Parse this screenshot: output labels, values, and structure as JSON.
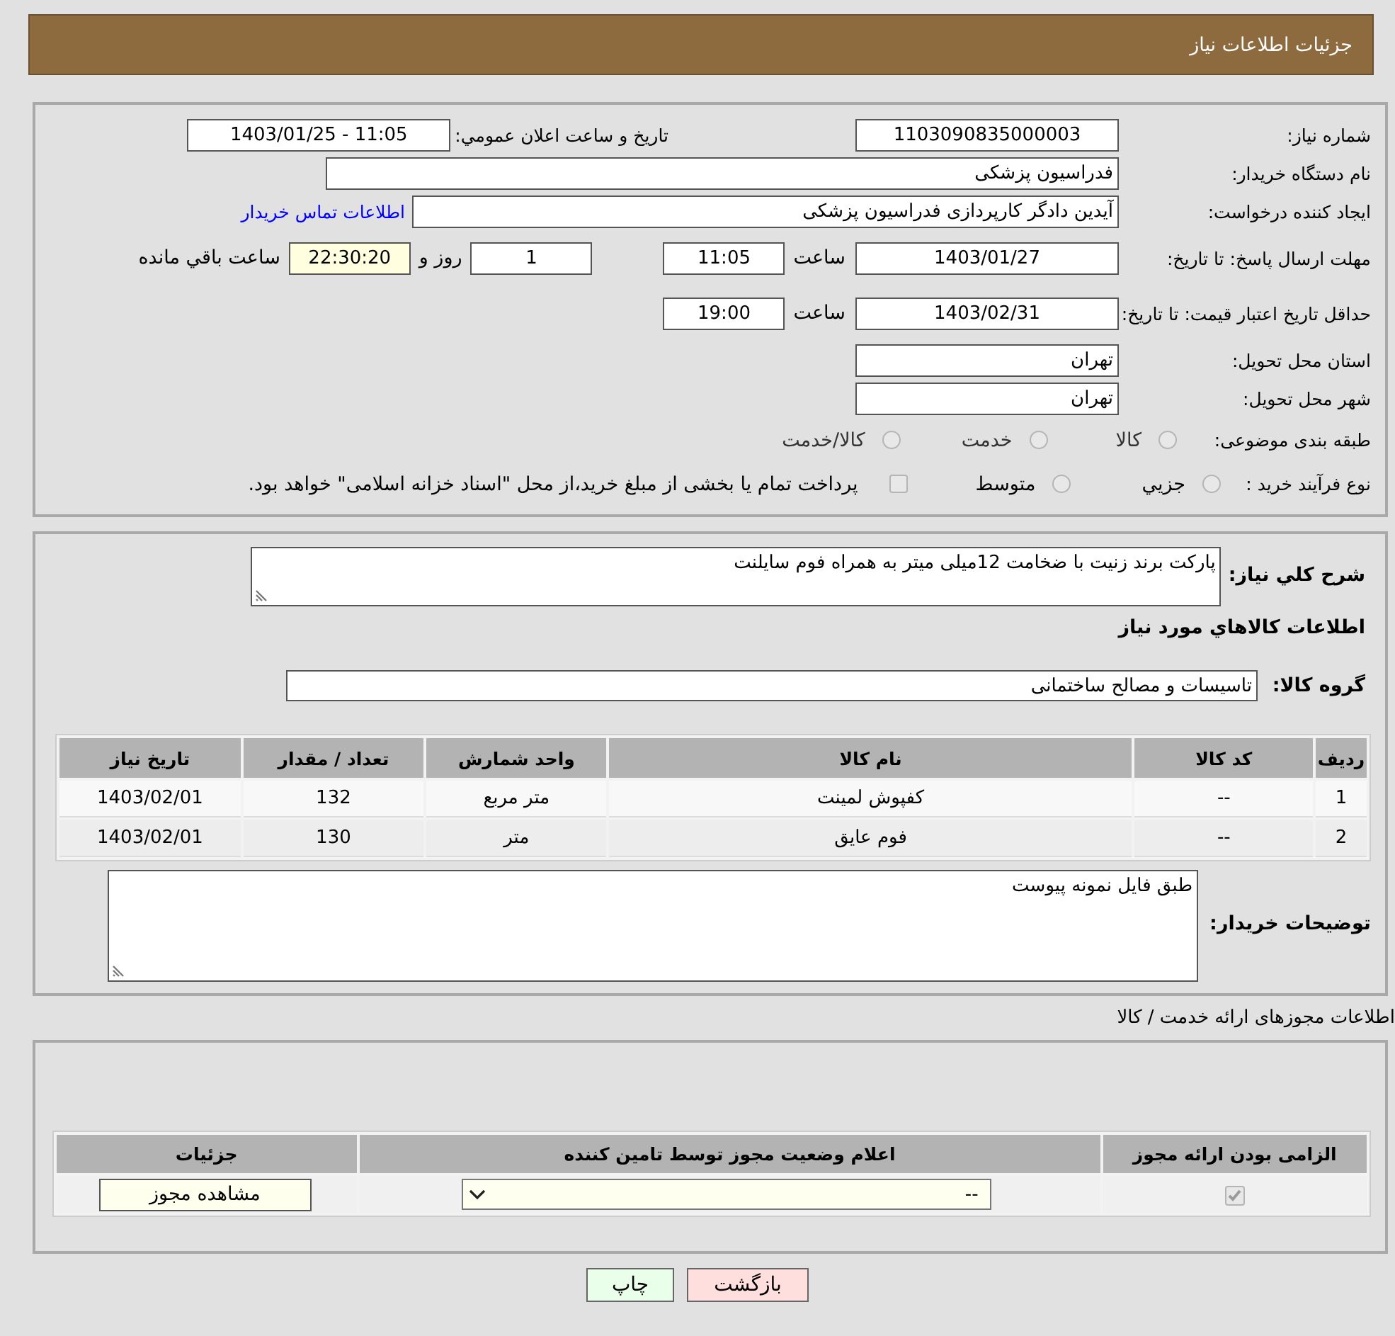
{
  "header": {
    "title": "جزئیات اطلاعات نیاز"
  },
  "details": {
    "need_number": {
      "label": "شماره نیاز:",
      "value": "1103090835000003"
    },
    "announce": {
      "label": "تاریخ و ساعت اعلان عمومي:",
      "value": "1403/01/25 - 11:05"
    },
    "buyer": {
      "label": "نام دستگاه خریدار:",
      "value": "فدراسیون پزشکی"
    },
    "creator": {
      "label": "ایجاد کننده درخواست:",
      "value": "آیدین  دادگر کارپردازی فدراسیون پزشکی",
      "link": "اطلاعات تماس خریدار"
    },
    "deadline": {
      "label": "مهلت ارسال پاسخ: تا تاریخ:",
      "date": "1403/01/27",
      "time_label": "ساعت",
      "time": "11:05",
      "days": "1",
      "days_label": "روز و",
      "remaining": "22:30:20",
      "remaining_label": "ساعت باقي مانده"
    },
    "validity": {
      "label": "حداقل تاریخ اعتبار قیمت: تا تاریخ:",
      "date": "1403/02/31",
      "time_label": "ساعت",
      "time": "19:00"
    },
    "province": {
      "label": "استان محل تحویل:",
      "value": "تهران"
    },
    "city": {
      "label": "شهر محل تحویل:",
      "value": "تهران"
    },
    "category": {
      "label": "طبقه بندی موضوعی:",
      "options": [
        {
          "label": "کالا",
          "selected": false,
          "disabled": true
        },
        {
          "label": "خدمت",
          "selected": false,
          "disabled": true
        },
        {
          "label": "کالا/خدمت",
          "selected": false,
          "disabled": true
        }
      ]
    },
    "process": {
      "label": "نوع فرآیند خرید :",
      "options": [
        {
          "label": "جزيي",
          "selected": false,
          "disabled": true
        },
        {
          "label": "متوسط",
          "selected": false,
          "disabled": true
        }
      ],
      "payment": {
        "label": "پرداخت تمام یا بخشی از مبلغ خرید،از محل \"اسناد خزانه اسلامی\" خواهد بود.",
        "checked": false,
        "disabled": true
      }
    }
  },
  "need": {
    "description": {
      "label": "شرح کلي نیاز:",
      "value": "پارکت برند زنیت با ضخامت 12میلی میتر به همراه فوم سایلنت"
    },
    "items_heading": "اطلاعات کالاهاي مورد نیاز",
    "group": {
      "label": "گروه کالا:",
      "value": "تاسیسات و مصالح ساختمانی"
    },
    "table": {
      "columns": [
        "ردیف",
        "کد کالا",
        "نام کالا",
        "واحد شمارش",
        "تعداد / مقدار",
        "تاریخ نیاز"
      ],
      "rows": [
        [
          "1",
          "--",
          "کفپوش لمینت",
          "متر مربع",
          "132",
          "1403/02/01"
        ],
        [
          "2",
          "--",
          "فوم عایق",
          "متر",
          "130",
          "1403/02/01"
        ]
      ]
    },
    "buyer_notes": {
      "label": "توضیحات خریدار:",
      "value": "طبق فایل نمونه پیوست"
    }
  },
  "permits": {
    "title": "اطلاعات مجوزهای ارائه خدمت / کالا",
    "columns": [
      "الزامی بودن ارائه مجوز",
      "اعلام وضعیت مجوز توسط تامین کننده",
      "جزئیات"
    ],
    "rows": [
      {
        "required": {
          "checked": true,
          "disabled": true
        },
        "status": "--",
        "details_button": "مشاهده مجوز"
      }
    ]
  },
  "actions": [
    {
      "label": "بازگشت",
      "kind": "back"
    },
    {
      "label": "چاپ",
      "kind": "print"
    }
  ]
}
